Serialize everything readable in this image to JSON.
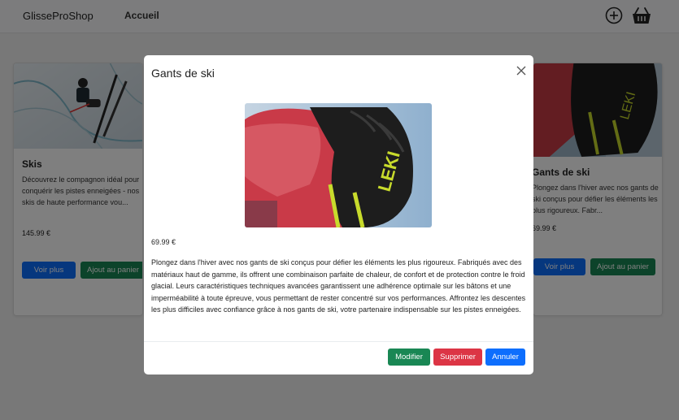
{
  "navbar": {
    "brand": "GlisseProShop",
    "home_link": "Accueil",
    "icons": [
      "plus-circle-icon",
      "basket-icon"
    ]
  },
  "cards": [
    {
      "title": "Skis",
      "description": "Découvrez le compagnon idéal pour conquérir les pistes enneigées - nos skis de haute performance vou...",
      "price": "145.99 €",
      "more_label": "Voir plus",
      "add_label": "Ajout au panier"
    },
    {
      "title": "Gants de ski",
      "description": "Plongez dans l'hiver avec nos gants de ski conçus pour défier les éléments les plus rigoureux. Fabr...",
      "price": "69.99 €",
      "more_label": "Voir plus",
      "add_label": "Ajout au panier"
    }
  ],
  "modal": {
    "title": "Gants de ski",
    "price": "69.99 €",
    "description": "Plongez dans l'hiver avec nos gants de ski conçus pour défier les éléments les plus rigoureux. Fabriqués avec des matériaux haut de gamme, ils offrent une combinaison parfaite de chaleur, de confort et de protection contre le froid glacial. Leurs caractéristiques techniques avancées garantissent une adhérence optimale sur les bâtons et une imperméabilité à toute épreuve, vous permettant de rester concentré sur vos performances. Affrontez les descentes les plus difficiles avec confiance grâce à nos gants de ski, votre partenaire indispensable sur les pistes enneigées.",
    "edit_label": "Modifier",
    "delete_label": "Supprimer",
    "cancel_label": "Annuler"
  },
  "colors": {
    "primary": "#0d6efd",
    "success": "#198754",
    "danger": "#dc3545"
  }
}
